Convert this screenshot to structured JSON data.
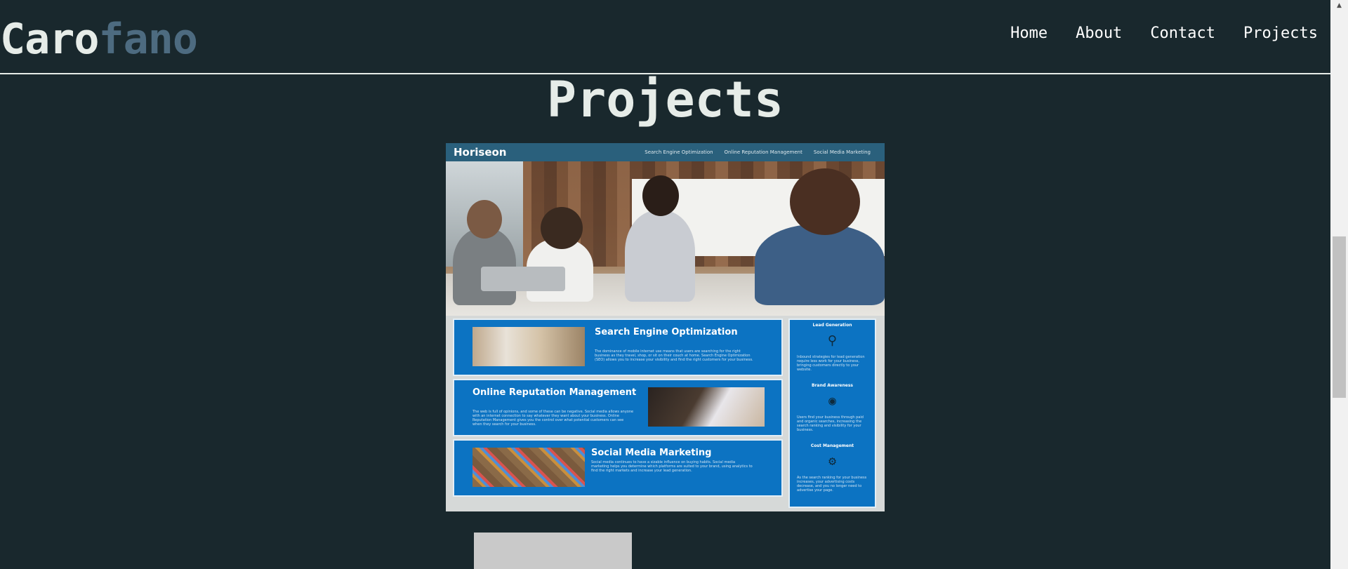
{
  "header": {
    "logo_part1": "Caro",
    "logo_part2": "fano",
    "nav": [
      "Home",
      "About",
      "Contact",
      "Projects"
    ]
  },
  "main": {
    "title": "Projects"
  },
  "project_screenshot": {
    "brand": "Horiseon",
    "nav": [
      "Search Engine Optimization",
      "Online Reputation Management",
      "Social Media Marketing"
    ],
    "cards": [
      {
        "title": "Search Engine Optimization",
        "text": "The dominance of mobile internet use means that users are searching for the right business as they travel, shop, or sit on their couch at home. Search Engine Optimization (SEO) allows you to increase your visibility and find the right customers for your business."
      },
      {
        "title": "Online Reputation Management",
        "text": "The web is full of opinions, and some of these can be negative. Social media allows anyone with an internet connection to say whatever they want about your business. Online Reputation Management gives you the control over what potential customers can see when they search for your business."
      },
      {
        "title": "Social Media Marketing",
        "text": "Social media continues to have a sizable influence on buying habits. Social media marketing helps you determine which platforms are suited to your brand, using analytics to find the right markets and increase your lead generation."
      }
    ],
    "aside": [
      {
        "title": "Lead Generation",
        "icon": "lead-generation-icon",
        "text": "Inbound strategies for lead generation require less work for your business, bringing customers directly to your website."
      },
      {
        "title": "Brand Awareness",
        "icon": "brand-awareness-icon",
        "text": "Users find your business through paid and organic searches, increasing the search ranking and visibility for your business."
      },
      {
        "title": "Cost Management",
        "icon": "cost-management-icon",
        "text": "As the search ranking for your business increases, your advertising costs decrease, and you no longer need to advertise your page."
      }
    ]
  },
  "colors": {
    "background": "#19282d",
    "logo_light": "#e6ece8",
    "logo_accent": "#4d6b80",
    "card_blue": "#0c73c2",
    "header_blue": "#2a607c"
  }
}
